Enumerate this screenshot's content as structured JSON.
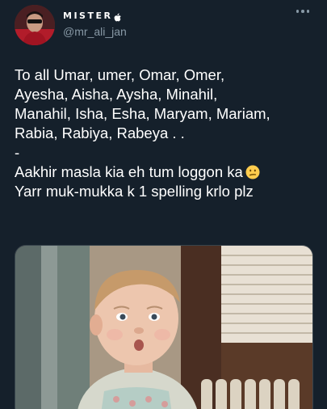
{
  "author": {
    "display_name": "MISTER",
    "handle": "@mr_ali_jan",
    "verified_icon": "apple-logo-icon"
  },
  "menu_icon": "more-horizontal-icon",
  "tweet": {
    "lines": [
      "To all Umar, umer, Omar, Omer,",
      "Ayesha, Aisha, Aysha, Minahil,",
      "Manahil, Isha, Esha, Maryam, Mariam,",
      "Rabia, Rabiya, Rabeya . .",
      "-",
      "Aakhir masla kia eh tum loggon ka",
      "Yarr muk-mukka k 1 spelling krlo plz"
    ],
    "emoji": "confused-face-emoji"
  },
  "media": {
    "type": "image",
    "subject": "toddler-photo"
  },
  "colors": {
    "background": "#15202b",
    "text": "#ffffff",
    "secondary": "#8899a6",
    "border": "#38444d"
  }
}
